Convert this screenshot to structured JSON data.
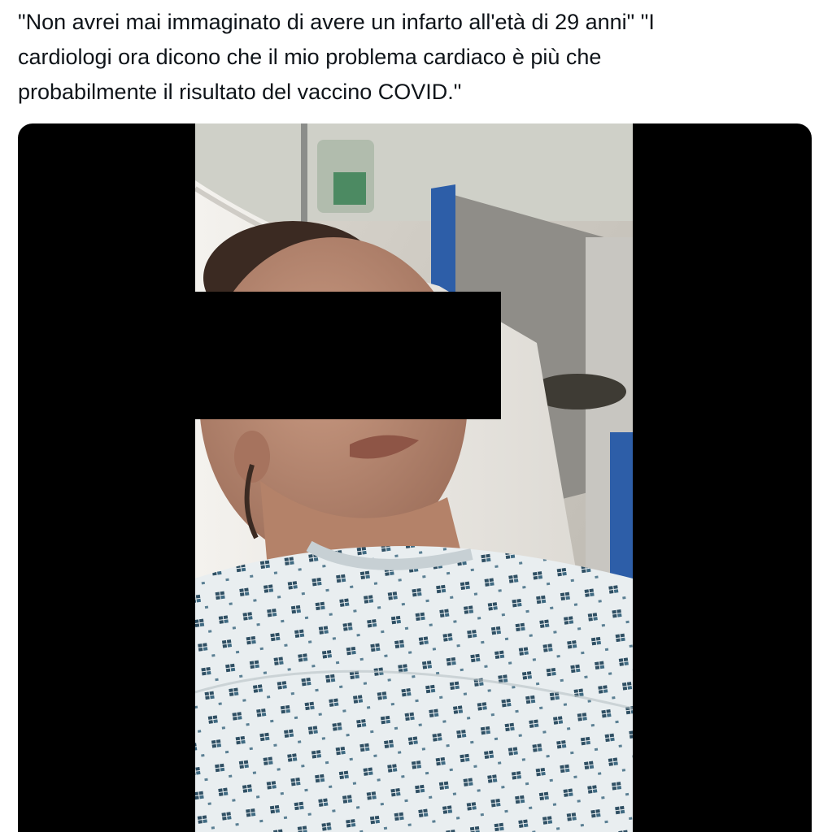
{
  "tweet": {
    "text": "\"Non avrei mai immaginato di avere un infarto all'età di 29 anni\" \"I\ncardiologi ora dicono che il mio problema cardiaco è più che\nprobabilmente il risultato del vaccino COVID.\""
  },
  "media": {
    "type": "video-frame",
    "subject": "patient-in-hospital-bed",
    "colors": {
      "letterbox": "#000000",
      "gown": "#e9eef0",
      "gown_pattern": "#2f4f63",
      "cabinet_blue": "#2d5ea8"
    }
  }
}
